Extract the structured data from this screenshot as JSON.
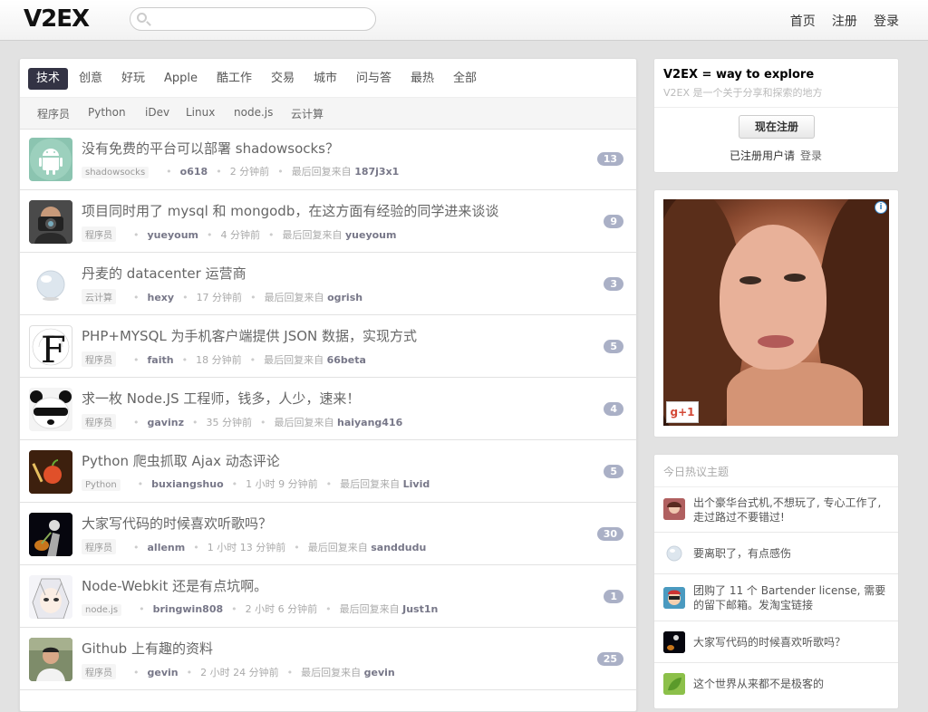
{
  "header": {
    "logo": "V2EX",
    "search": {
      "value": "",
      "placeholder": ""
    },
    "nav": [
      "首页",
      "注册",
      "登录"
    ]
  },
  "tabs": [
    "技术",
    "创意",
    "好玩",
    "Apple",
    "酷工作",
    "交易",
    "城市",
    "问与答",
    "最热",
    "全部"
  ],
  "active_tab": "技术",
  "subtabs": [
    "程序员",
    "Python",
    "iDev",
    "Linux",
    "node.js",
    "云计算"
  ],
  "topics": [
    {
      "title": "没有免费的平台可以部署 shadowsocks？",
      "node": "shadowsocks",
      "author": "o618",
      "time": "2 分钟前",
      "last_prefix": "最后回复来自",
      "last_reply": "187j3x1",
      "replies": "13",
      "avatar_icon": "android-icon"
    },
    {
      "title": "项目同时用了 mysql 和 mongodb，在这方面有经验的同学进来谈谈",
      "node": "程序员",
      "author": "yueyoum",
      "time": "4 分钟前",
      "last_prefix": "最后回复来自",
      "last_reply": "yueyoum",
      "replies": "9",
      "avatar_icon": "camera-man-avatar"
    },
    {
      "title": "丹麦的 datacenter 运营商",
      "node": "云计算",
      "author": "hexy",
      "time": "17 分钟前",
      "last_prefix": "最后回复来自",
      "last_reply": "ogrish",
      "replies": "3",
      "avatar_icon": "crystal-ball-avatar"
    },
    {
      "title": "PHP+MYSQL 为手机客户端提供 JSON 数据，实现方式",
      "node": "程序员",
      "author": "faith",
      "time": "18 分钟前",
      "last_prefix": "最后回复来自",
      "last_reply": "66beta",
      "replies": "5",
      "avatar_icon": "letter-f-avatar"
    },
    {
      "title": "求一枚 Node.JS 工程师，钱多，人少，速来！",
      "node": "程序员",
      "author": "gavinz",
      "time": "35 分钟前",
      "last_prefix": "最后回复来自",
      "last_reply": "haiyang416",
      "replies": "4",
      "avatar_icon": "panda-avatar"
    },
    {
      "title": "Python 爬虫抓取 Ajax 动态评论",
      "node": "Python",
      "author": "buxiangshuo",
      "time": "1 小时 9 分钟前",
      "last_prefix": "最后回复来自",
      "last_reply": "Livid",
      "replies": "5",
      "avatar_icon": "apple-avatar"
    },
    {
      "title": "大家写代码的时候喜欢听歌吗？",
      "node": "程序员",
      "author": "allenm",
      "time": "1 小时 13 分钟前",
      "last_prefix": "最后回复来自",
      "last_reply": "sanddudu",
      "replies": "30",
      "avatar_icon": "guitar-avatar"
    },
    {
      "title": "Node-Webkit 还是有点坑啊。",
      "node": "node.js",
      "author": "bringwin808",
      "time": "2 小时 6 分钟前",
      "last_prefix": "最后回复来自",
      "last_reply": "Just1n",
      "replies": "1",
      "avatar_icon": "anime-avatar"
    },
    {
      "title": "Github 上有趣的资料",
      "node": "程序员",
      "author": "gevin",
      "time": "2 小时 24 分钟前",
      "last_prefix": "最后回复来自",
      "last_reply": "gevin",
      "replies": "25",
      "avatar_icon": "person-avatar"
    }
  ],
  "sidebar": {
    "title": "V2EX = way to explore",
    "subtitle": "V2EX 是一个关于分享和探索的地方",
    "register_button": "现在注册",
    "already_text": "已注册用户请",
    "login_link": "登录",
    "ad": {
      "gplus": "g+1",
      "info": "i"
    },
    "hot_title": "今日热议主题",
    "hot_items": [
      {
        "title": "出个豪华台式机,不想玩了, 专心工作了, 走过路过不要错过!",
        "avatar_icon": "girl-avatar"
      },
      {
        "title": "要离职了，有点感伤",
        "avatar_icon": "crystal-ball-avatar"
      },
      {
        "title": "团购了 11 个 Bartender license, 需要的留下邮箱。发淘宝链接",
        "avatar_icon": "cartoon-avatar"
      },
      {
        "title": "大家写代码的时候喜欢听歌吗？",
        "avatar_icon": "guitar-avatar"
      },
      {
        "title": "这个世界从来都不是极客的",
        "avatar_icon": "leaf-avatar"
      }
    ]
  }
}
